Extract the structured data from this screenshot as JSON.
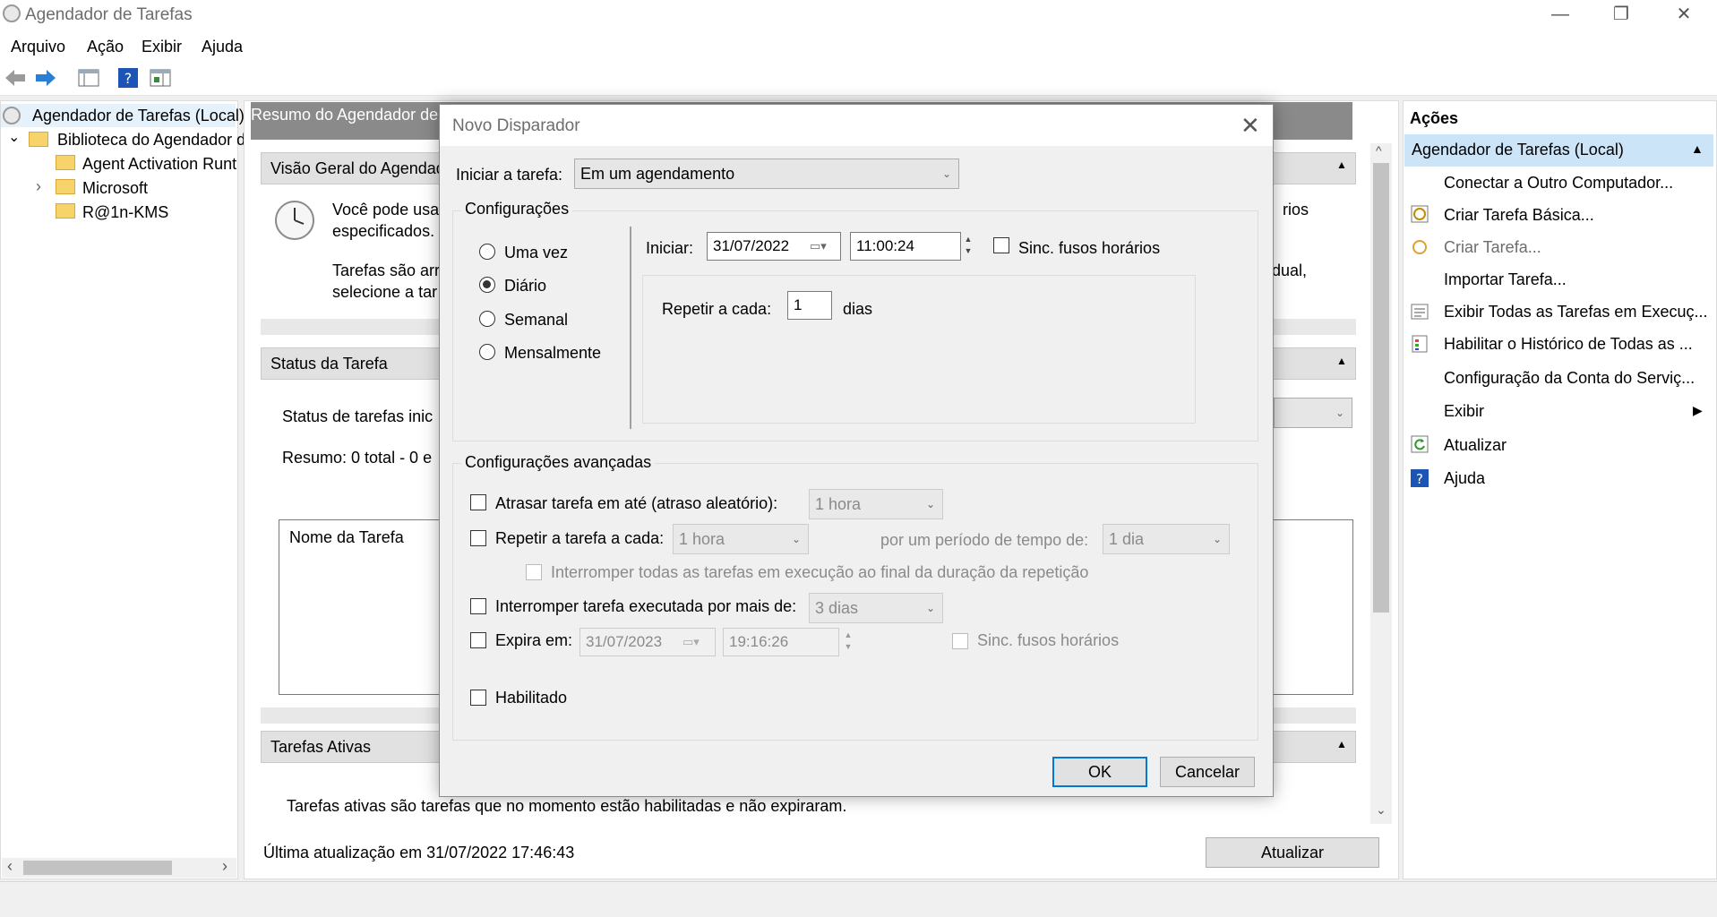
{
  "window": {
    "title": "Agendador de Tarefas",
    "controls": {
      "minimize": "—",
      "restore": "❐",
      "close": "✕"
    }
  },
  "menu": [
    "Arquivo",
    "Ação",
    "Exibir",
    "Ajuda"
  ],
  "toolbar": {
    "icons": [
      "back-arrow-icon",
      "forward-arrow-icon",
      "console-tree-icon",
      "help-icon",
      "action-pane-icon"
    ]
  },
  "tree": {
    "root": "Agendador de Tarefas (Local)",
    "library": "Biblioteca do Agendador d",
    "children": [
      "Agent Activation Runt",
      "Microsoft",
      "R@1n-KMS"
    ],
    "expand_glyph": "›",
    "collapse_glyph": "⌄"
  },
  "middle": {
    "header": "Resumo do Agendador de",
    "overview": {
      "title": "Visão Geral do Agendad",
      "line1": "Você pode usa",
      "line1_end": "rios",
      "line2": "especificados.",
      "line3": "Tarefas são arr",
      "line3_end": "dual,",
      "line4": "selecione a tar"
    },
    "status": {
      "title": "Status da Tarefa",
      "label": "Status de tarefas inic",
      "summary": "Resumo: 0 total - 0 e",
      "column": "Nome da Tarefa"
    },
    "active": {
      "title": "Tarefas Ativas",
      "text": "Tarefas ativas são tarefas que no momento estão habilitadas e não expiraram."
    },
    "last_update": "Última atualização em 31/07/2022 17:46:43",
    "refresh_button": "Atualizar"
  },
  "actions": {
    "title": "Ações",
    "group": "Agendador de Tarefas (Local)",
    "items": [
      "Conectar a Outro Computador...",
      "Criar Tarefa Básica...",
      "Criar Tarefa...",
      "Importar Tarefa...",
      "Exibir Todas as Tarefas em Execuç...",
      "Habilitar o Histórico de Todas as ...",
      "Configuração da Conta do Serviç...",
      "Exibir",
      "Atualizar",
      "Ajuda"
    ]
  },
  "dialog": {
    "title": "Novo Disparador",
    "start_task_label": "Iniciar a tarefa:",
    "start_task_value": "Em um agendamento",
    "settings_label": "Configurações",
    "frequency": [
      "Uma vez",
      "Diário",
      "Semanal",
      "Mensalmente"
    ],
    "selected_frequency": "Diário",
    "start_label": "Iniciar:",
    "start_date": "31/07/2022",
    "start_time": "11:00:24",
    "sync_timezones": "Sinc. fusos horários",
    "repeat_every_label": "Repetir a cada:",
    "repeat_every_value": "1",
    "repeat_unit": "dias",
    "advanced_label": "Configurações avançadas",
    "delay_label": "Atrasar tarefa em até (atraso aleatório):",
    "delay_value": "1 hora",
    "repeat_task_label": "Repetir a tarefa a cada:",
    "repeat_task_value": "1 hora",
    "duration_label": "por um período de tempo de:",
    "duration_value": "1 dia",
    "stop_all_label": "Interromper todas as tarefas em execução ao final da duração da repetição",
    "stop_longer_label": "Interromper tarefa executada por mais de:",
    "stop_longer_value": "3 dias",
    "expire_label": "Expira em:",
    "expire_date": "31/07/2023",
    "expire_time": "19:16:26",
    "expire_sync": "Sinc. fusos horários",
    "enabled_label": "Habilitado",
    "ok": "OK",
    "cancel": "Cancelar"
  },
  "colors": {
    "accent": "#0078d7",
    "actions_group_bg": "#cce4f7"
  }
}
